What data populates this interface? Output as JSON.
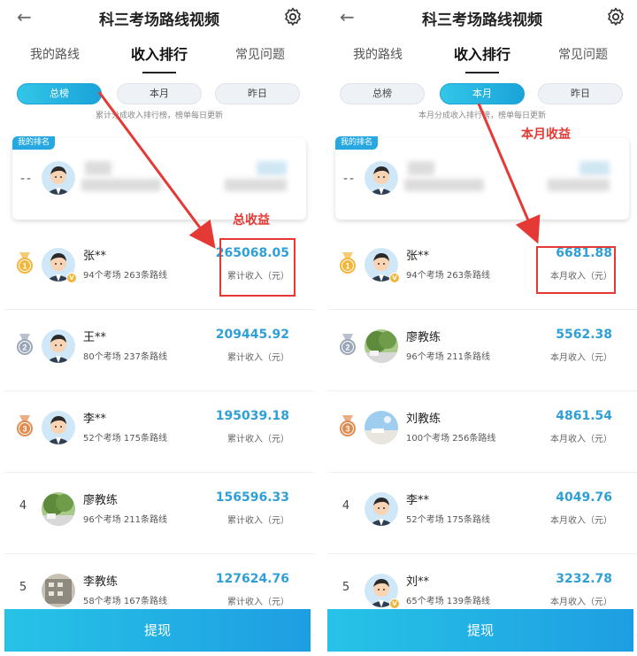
{
  "colors": {
    "accent": "#1aa3d9",
    "amount": "#2fa0d6",
    "annotation": "#e53935",
    "gold": "#f1b63a",
    "silver": "#9aa7b8",
    "bronze": "#e08b4f"
  },
  "panels": [
    {
      "back_icon": "←",
      "title": "科三考场路线视频",
      "tabs": [
        "我的路线",
        "收入排行",
        "常见问题"
      ],
      "active_tab": 1,
      "pills": [
        "总榜",
        "本月",
        "昨日"
      ],
      "active_pill": 0,
      "subnote": "累计分成收入排行榜，榜单每日更新",
      "my_rank": {
        "badge": "我的排名",
        "rank": "--"
      },
      "annotation": "总收益",
      "rows": [
        {
          "rank": "1",
          "medal": "gold",
          "name": "张**",
          "sub": "94个考场 263条路线",
          "amount": "265068.05",
          "label": "累计收入（元）",
          "avatar": "cartoon",
          "badge": true
        },
        {
          "rank": "2",
          "medal": "silver",
          "name": "王**",
          "sub": "80个考场 237条路线",
          "amount": "209445.92",
          "label": "累计收入（元）",
          "avatar": "cartoon",
          "badge": false
        },
        {
          "rank": "3",
          "medal": "bronze",
          "name": "李**",
          "sub": "52个考场 175条路线",
          "amount": "195039.18",
          "label": "累计收入（元）",
          "avatar": "cartoon",
          "badge": false
        },
        {
          "rank": "4",
          "medal": "",
          "name": "廖教练",
          "sub": "96个考场 211条路线",
          "amount": "156596.33",
          "label": "累计收入（元）",
          "avatar": "tree",
          "badge": false
        },
        {
          "rank": "5",
          "medal": "",
          "name": "李教练",
          "sub": "58个考场 167条路线",
          "amount": "127624.76",
          "label": "累计收入（元）",
          "avatar": "building",
          "badge": false
        }
      ],
      "withdraw": "提现"
    },
    {
      "back_icon": "←",
      "title": "科三考场路线视频",
      "tabs": [
        "我的路线",
        "收入排行",
        "常见问题"
      ],
      "active_tab": 1,
      "pills": [
        "总榜",
        "本月",
        "昨日"
      ],
      "active_pill": 1,
      "subnote": "本月分成收入排行榜，榜单每日更新",
      "my_rank": {
        "badge": "我的排名",
        "rank": "--"
      },
      "annotation": "本月收益",
      "rows": [
        {
          "rank": "1",
          "medal": "gold",
          "name": "张**",
          "sub": "94个考场 263条路线",
          "amount": "6681.88",
          "label": "本月收入（元）",
          "avatar": "cartoon",
          "badge": true
        },
        {
          "rank": "2",
          "medal": "silver",
          "name": "廖教练",
          "sub": "96个考场 211条路线",
          "amount": "5562.38",
          "label": "本月收入（元）",
          "avatar": "tree",
          "badge": false
        },
        {
          "rank": "3",
          "medal": "bronze",
          "name": "刘教练",
          "sub": "100个考场 256条路线",
          "amount": "4861.54",
          "label": "本月收入（元）",
          "avatar": "sky",
          "badge": false
        },
        {
          "rank": "4",
          "medal": "",
          "name": "李**",
          "sub": "52个考场 175条路线",
          "amount": "4049.76",
          "label": "本月收入（元）",
          "avatar": "cartoon",
          "badge": false
        },
        {
          "rank": "5",
          "medal": "",
          "name": "刘**",
          "sub": "65个考场 139条路线",
          "amount": "3232.78",
          "label": "本月收入（元）",
          "avatar": "cartoon",
          "badge": true
        }
      ],
      "withdraw": "提现"
    }
  ]
}
